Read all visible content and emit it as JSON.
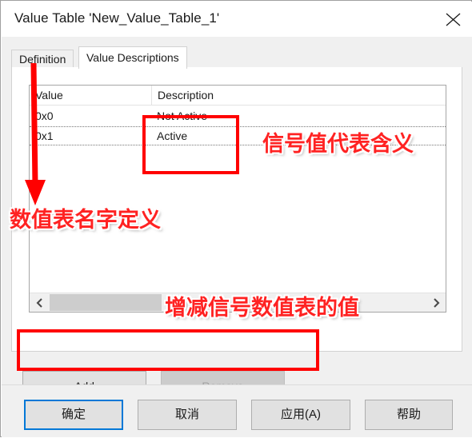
{
  "window": {
    "title": "Value Table 'New_Value_Table_1'",
    "close_icon": "close-icon"
  },
  "tabs": [
    {
      "label": "Definition",
      "active": false
    },
    {
      "label": "Value Descriptions",
      "active": true
    }
  ],
  "list": {
    "columns": [
      "Value",
      "Description"
    ],
    "rows": [
      {
        "value": "0x0",
        "description": "Not Active",
        "selected": false
      },
      {
        "value": "0x1",
        "description": "Active",
        "selected": true
      }
    ],
    "scrollbar": {
      "left_arrow_icon": "chevron-left-icon",
      "right_arrow_icon": "chevron-right-icon"
    }
  },
  "mid_buttons": {
    "add_label": "Add",
    "remove_label": "Remove",
    "remove_disabled": true
  },
  "bottom_buttons": {
    "ok_label": "确定",
    "cancel_label": "取消",
    "apply_label": "应用(A)",
    "help_label": "帮助"
  },
  "annotations": {
    "color": "#ff0000",
    "description_note": "信号值代表含义",
    "name_note": "数值表名字定义",
    "addremove_note": "增减信号数值表的值"
  }
}
